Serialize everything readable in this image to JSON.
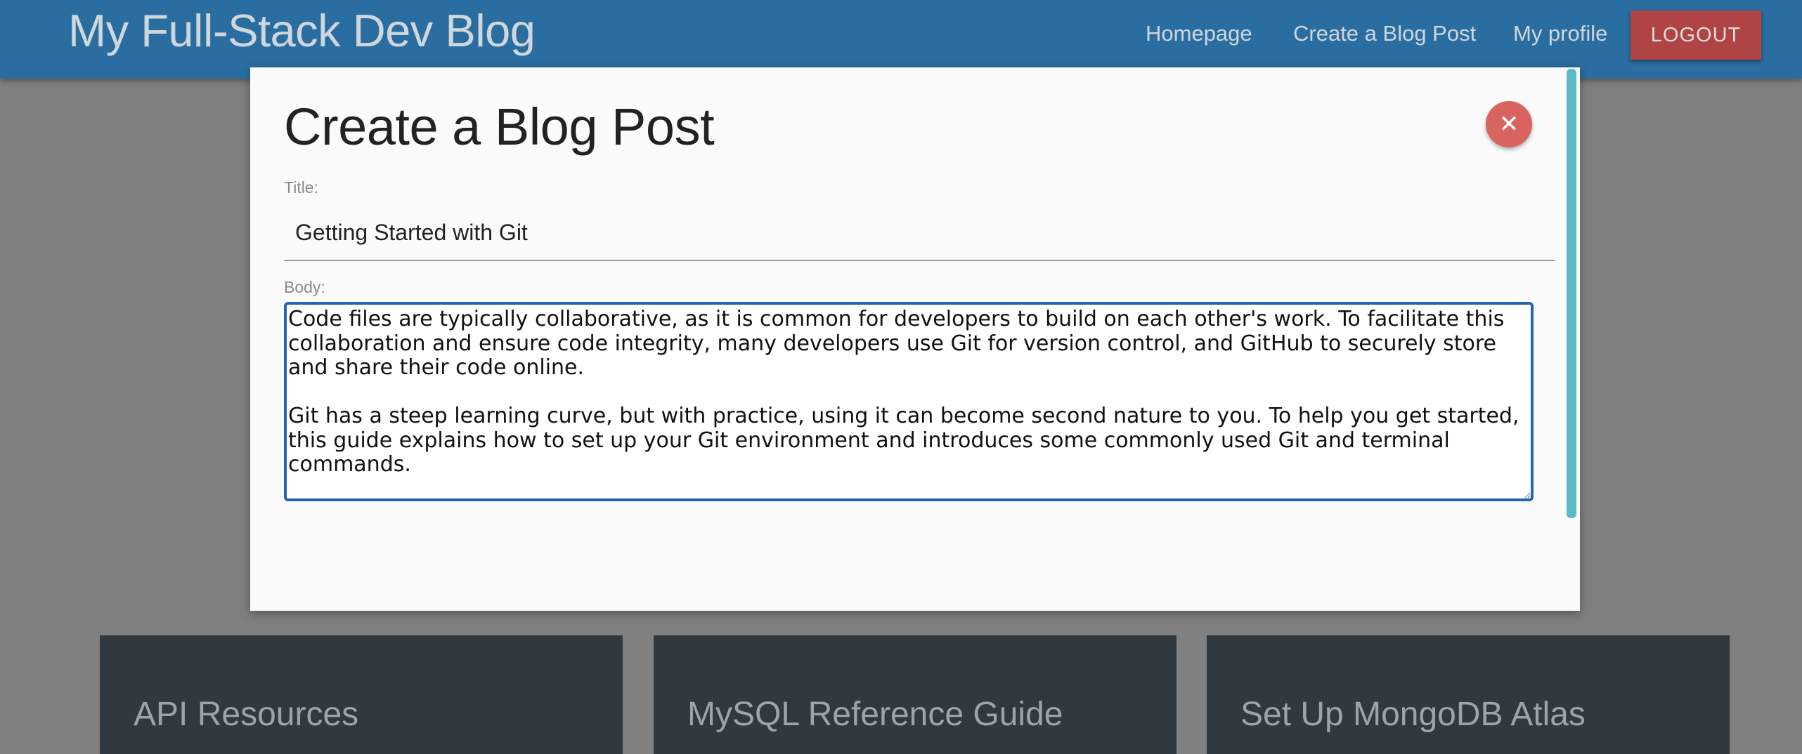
{
  "navbar": {
    "brand": "My Full-Stack Dev Blog",
    "links": [
      "Homepage",
      "Create a Blog Post",
      "My profile"
    ],
    "logout_label": "LOGOUT"
  },
  "cards": [
    "API Resources",
    "MySQL Reference Guide",
    "Set Up MongoDB Atlas"
  ],
  "modal": {
    "title": "Create a Blog Post",
    "close_glyph": "✕",
    "title_label": "Title:",
    "title_value": "Getting Started with Git",
    "body_label": "Body:",
    "body_value": "Code files are typically collaborative, as it is common for developers to build on each other's work. To facilitate this collaboration and ensure code integrity, many developers use Git for version control, and GitHub to securely store and share their code online.\n\nGit has a steep learning curve, but with practice, using it can become second nature to you. To help you get started, this guide explains how to set up your Git environment and introduces some commonly used Git and terminal commands.\n\nFirst, we'll walk through how to set up your Git username, which enables Git to associate commits with your identity."
  },
  "colors": {
    "navbar": "#2a6ea1",
    "logout": "#b04444",
    "close_button": "#d9645f",
    "textarea_focus": "#2564b0",
    "scrollbar": "#5bbcc8"
  }
}
